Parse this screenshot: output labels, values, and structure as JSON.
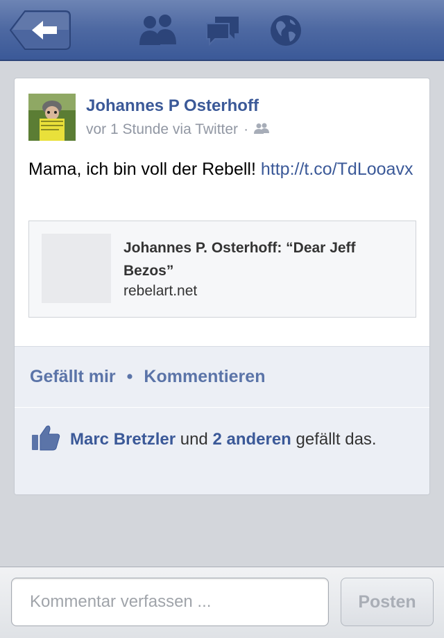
{
  "nav": {
    "icons": [
      "back-arrow-icon",
      "friend-requests-icon",
      "messages-icon",
      "notifications-globe-icon"
    ]
  },
  "post": {
    "author": "Johannes P Osterhoff",
    "time": "vor 1 Stunde via Twitter",
    "separator": "·",
    "privacy_icon": "friends-icon",
    "text": "Mama, ich bin voll der Rebell! ",
    "link": "http://t.co/TdLooavx",
    "link_preview": {
      "title": "Johannes P. Osterhoff: “Dear Jeff Bezos”",
      "domain": "rebelart.net"
    }
  },
  "actions": {
    "like_label": "Gefällt mir",
    "separator": "•",
    "comment_label": "Kommentieren"
  },
  "likes": {
    "icon": "thumbs-up-icon",
    "person": "Marc Bretzler",
    "conjunction": " und ",
    "others": "2 anderen",
    "suffix": " gefällt das."
  },
  "comment_bar": {
    "placeholder": "Kommentar verfassen ...",
    "post_label": "Posten"
  },
  "colors": {
    "brand": "#3b5998",
    "navbar_top": "#6d84b4",
    "action_text": "#5b74a8",
    "meta_text": "#9197a3"
  }
}
